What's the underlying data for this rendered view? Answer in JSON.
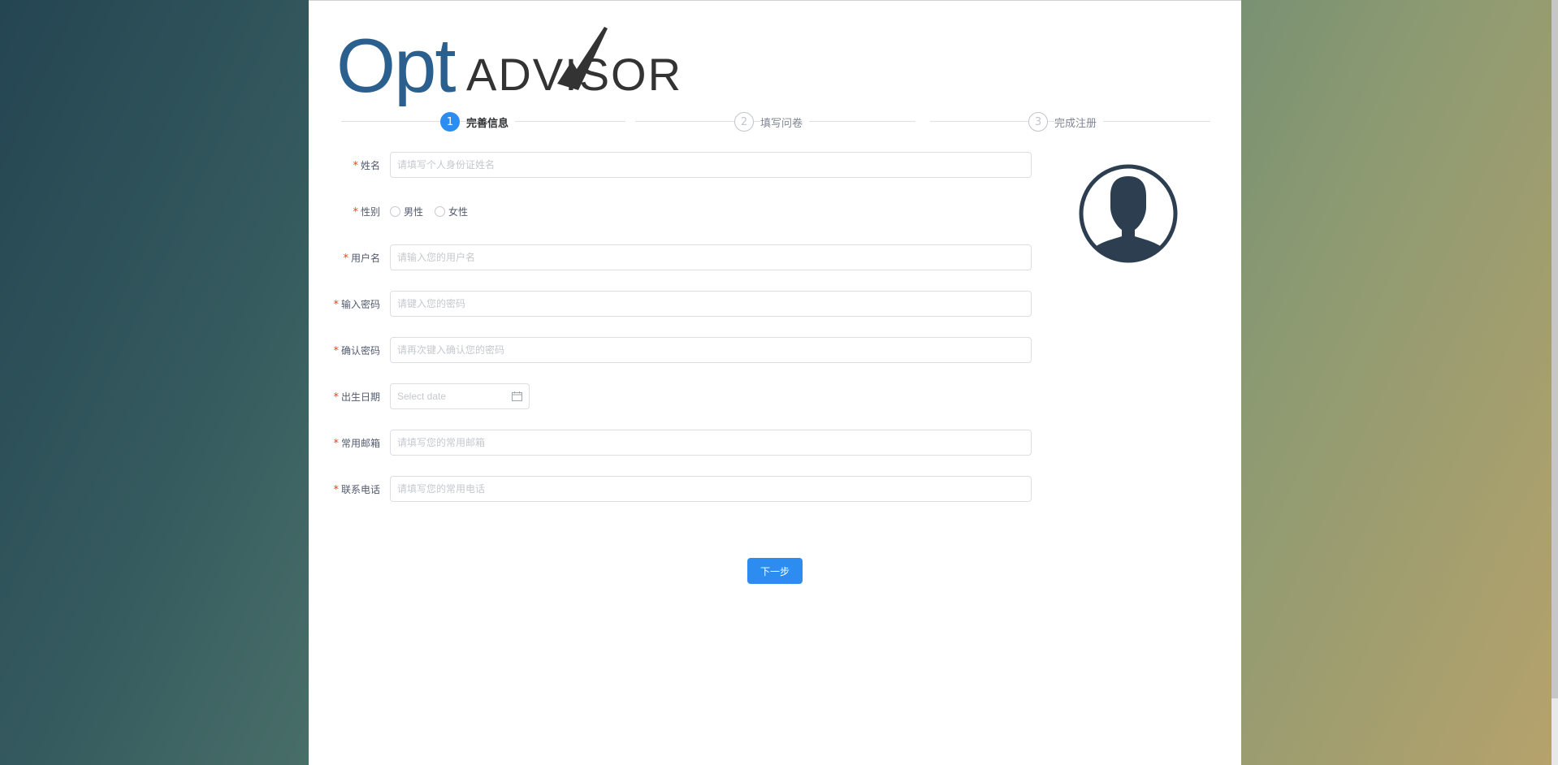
{
  "brand": {
    "logo_part1": "Opt",
    "logo_part2": "ADVISOR",
    "primary_color": "#2b5f8e",
    "secondary_color": "#333333"
  },
  "steps": [
    {
      "number": "1",
      "label": "完善信息",
      "state": "active"
    },
    {
      "number": "2",
      "label": "填写问卷",
      "state": "pending"
    },
    {
      "number": "3",
      "label": "完成注册",
      "state": "pending"
    }
  ],
  "form": {
    "name": {
      "label": "姓名",
      "placeholder": "请填写个人身份证姓名",
      "value": ""
    },
    "gender": {
      "label": "性别",
      "options": [
        "男性",
        "女性"
      ],
      "selected": ""
    },
    "username": {
      "label": "用户名",
      "placeholder": "请输入您的用户名",
      "value": ""
    },
    "password": {
      "label": "输入密码",
      "placeholder": "请键入您的密码",
      "value": ""
    },
    "confirm_password": {
      "label": "确认密码",
      "placeholder": "请再次键入确认您的密码",
      "value": ""
    },
    "birthdate": {
      "label": "出生日期",
      "placeholder": "Select date",
      "value": ""
    },
    "email": {
      "label": "常用邮箱",
      "placeholder": "请填写您的常用邮箱",
      "value": ""
    },
    "phone": {
      "label": "联系电话",
      "placeholder": "请填写您的常用电话",
      "value": ""
    }
  },
  "required_marker": "*",
  "next_button": "下一步",
  "icons": {
    "avatar": "user-silhouette-icon",
    "date": "calendar-icon"
  },
  "colors": {
    "accent": "#2d8cf0",
    "required": "#ed4014",
    "avatar": "#2c3e50"
  }
}
